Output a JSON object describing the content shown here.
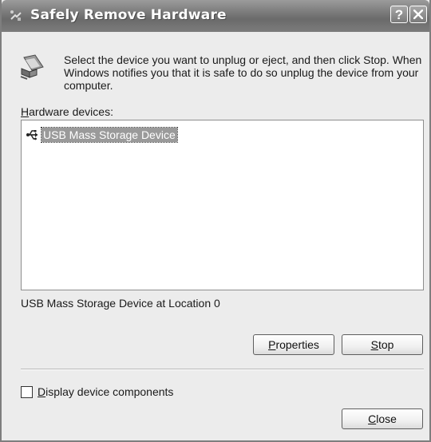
{
  "window": {
    "title": "Safely Remove Hardware",
    "help_glyph": "?",
    "icons": {
      "title": "usb-eject-icon",
      "help": "help-icon",
      "close": "close-icon"
    }
  },
  "instruction": {
    "icon": "hardware-icon",
    "text": "Select the device you want to unplug or eject, and then click Stop. When Windows notifies you that it is safe to do so unplug the device from your computer."
  },
  "devices": {
    "label_accel": "H",
    "label_rest": "ardware devices:",
    "items": [
      {
        "icon": "usb-icon",
        "name": "USB Mass Storage Device",
        "selected": true
      }
    ]
  },
  "selected_location": "USB Mass Storage Device at Location 0",
  "buttons": {
    "properties_accel": "P",
    "properties_rest": "roperties",
    "stop_accel": "S",
    "stop_rest": "top",
    "close_accel": "C",
    "close_rest": "lose"
  },
  "checkbox": {
    "checked": false,
    "label_accel": "D",
    "label_rest": "isplay device components"
  },
  "colors": {
    "titlebar": "#7a7a7a",
    "selection": "#9a9a9a",
    "dialog_bg": "#ececec"
  }
}
